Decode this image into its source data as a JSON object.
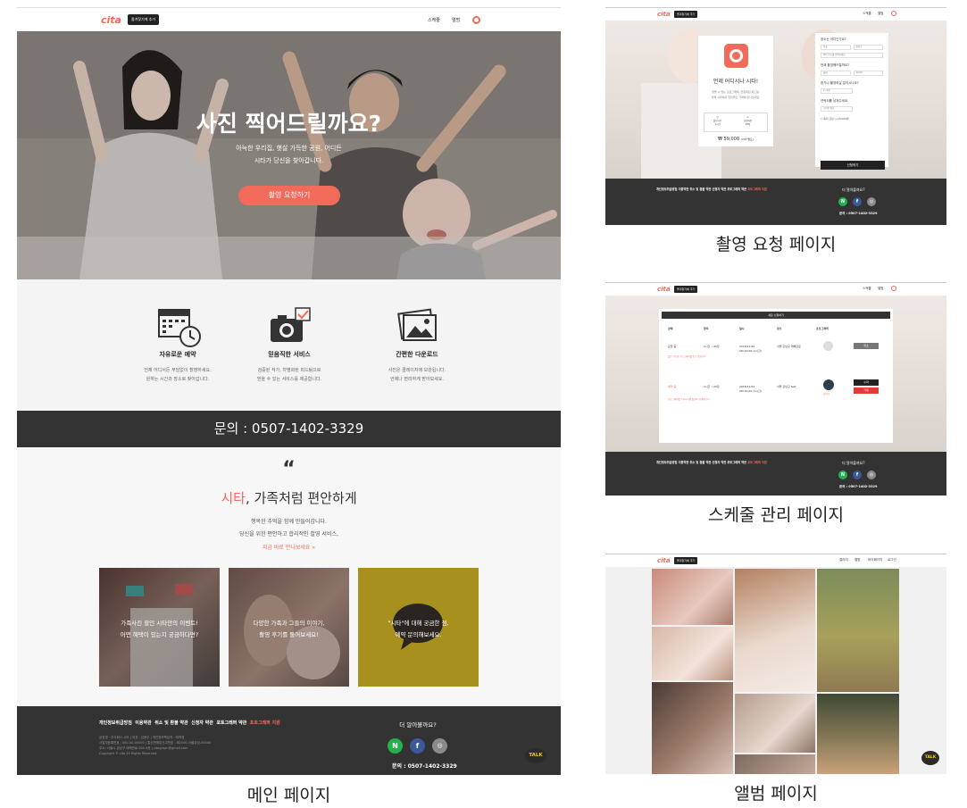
{
  "main_page": {
    "header": {
      "logo": "cita",
      "favorite_button": "즐겨찾기에 추가",
      "nav": [
        "스케줄",
        "앨범"
      ]
    },
    "hero": {
      "title": "사진 찍어드릴까요?",
      "subtitle_line1": "아늑한 우리집, 햇살 가득한 공원, 어디든",
      "subtitle_line2": "시타가 당신을 찾아갑니다.",
      "cta": "촬영 요청하기"
    },
    "features": [
      {
        "icon": "calendar-clock-icon",
        "title": "자유로운 예약",
        "desc1": "언제 어디서든 부담없이 촬영하세요.",
        "desc2": "원하는 시간과 장소로 찾아갑니다."
      },
      {
        "icon": "camera-check-icon",
        "title": "믿음직한 서비스",
        "desc1": "검증된 작가, 차별화된 피드팀으로",
        "desc2": "믿을 수 있는 서비스를 제공합니다."
      },
      {
        "icon": "photos-icon",
        "title": "간편한 다운로드",
        "desc1": "사진은 클레이지에 보관됩니다.",
        "desc2": "언제나 편리하게 받아보세요."
      }
    ],
    "contact": "문의 : 0507-1402-3329",
    "quote": {
      "mark": "“",
      "title_highlight": "시타",
      "title_rest": ", 가족처럼 편안하게",
      "desc1": "행복한 추억을 함께 만들어갑니다.",
      "desc2": "당신을 위한 편안하고 합리적인 촬영 서비스,",
      "link": "지금 바로 만나보세요 »"
    },
    "tiles": [
      {
        "line1": "가족사진 할인 시타만의 이벤트!",
        "line2": "어떤 혜택이 있는지 궁금하다면?"
      },
      {
        "line1": "다양한 가족과 그들의 이야기,",
        "line2": "촬영 후기를 둘어보세요!"
      },
      {
        "line1": "\"시타\"에 대해 궁금한 점,",
        "line2": "예약 문의해보세요."
      }
    ],
    "footer": {
      "links": [
        "개인정보취급방침",
        "이용약관",
        "취소 및 환불 약관",
        "신청자 약관",
        "포토그래퍼 약관"
      ],
      "link_highlight": "포토그래퍼 지원",
      "info": [
        "상호명 : 주식회사 시타 | 대표 : 김용우 | 개인정보책임자 : 최하영",
        "사업자등록번호 : 000-00-00000 | 통신판매업신고번호 : 제2000-서울강남-00000",
        "주소: 서울시 강남구 테헤란로 000 0층 | citagraph@gmail.com",
        "Copyright © cita All Rights Reserved."
      ],
      "more": "더 알아볼까요?",
      "phone": "문의 : 0507-1402-3329",
      "talk": "TALK"
    },
    "caption": "메인 페이지"
  },
  "booking_page": {
    "card": {
      "title": "언제 어디서나 시타!",
      "desc1": "믿을 수 있는 포토그래퍼, 전문화된 피드팀.",
      "desc2": "언제 시타에서 합리적인 가격에 만나보세요.",
      "opt1_label": "촬영시간",
      "opt1_value": "1시간",
      "opt2_label": "보정사진",
      "opt2_value": "20장",
      "price": "₩ 59,000",
      "price_note": "(VAT 별도)"
    },
    "form": {
      "q1": "장소는 어디인가요?",
      "city": "서울",
      "district": "강남구",
      "address": "세부 주소를 입력하세요",
      "q2": "언제 촬영해드릴까요?",
      "date": "날짜",
      "time": "10:00",
      "q3": "참가나 촬영하실 분이시나요?",
      "people": "2~4명",
      "q4": "연락처를 남겨주세요.",
      "phone": "휴대폰 번호",
      "agree": "동의 요청 (+20,000원)",
      "submit": "신청하기"
    },
    "caption": "촬영 요청 페이지"
  },
  "schedule_page": {
    "header": "새로 신청하기",
    "columns": [
      "상태",
      "항목",
      "일시",
      "장소",
      "포토그래퍼"
    ],
    "rows": [
      {
        "status": "요청 중",
        "item": "1시간 • 20장",
        "date": "2016/11/22",
        "time": "AM 10:00 (1시간)",
        "place": "서울 강남구 테헤란로",
        "btn": "취소",
        "note": "촬영 가능한 포토그래퍼를 찾고 있습니다."
      },
      {
        "status": "예약 중",
        "item": "1시간 • 20장",
        "date": "2016/11/22",
        "time": "AM 10:00 (1시간)",
        "place": "서울 강남구 test",
        "btn1": "수락",
        "btn2": "거절",
        "photographer": "김작가",
        "note": "포토그래퍼를 수락하시면 촬영이 진행됩니다."
      }
    ],
    "caption": "스케줄 관리 페이지"
  },
  "album_page": {
    "nav": [
      "갤러리",
      "앨범",
      "마이페이지",
      "로그인"
    ],
    "talk": "TALK",
    "caption": "앨범 페이지"
  },
  "colors": {
    "accent": "#f26a5a",
    "dark": "#333333",
    "mustard": "#a8901f",
    "naver": "#22b14c",
    "facebook": "#3b5998",
    "instagram": "#8a8a8a"
  }
}
